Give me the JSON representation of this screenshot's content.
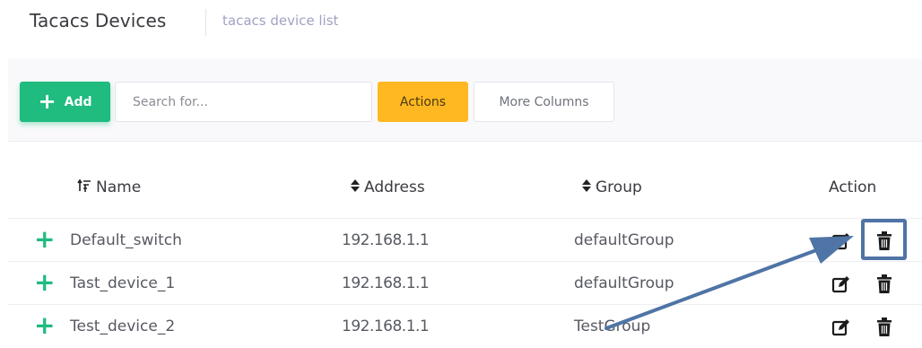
{
  "header": {
    "title": "Tacacs Devices",
    "subtitle": "tacacs device list"
  },
  "toolbar": {
    "add_label": "Add",
    "add_icon": "plus-icon",
    "search_placeholder": "Search for...",
    "actions_label": "Actions",
    "more_columns_label": "More Columns"
  },
  "table": {
    "columns": {
      "name": "Name",
      "address": "Address",
      "group": "Group",
      "action": "Action"
    },
    "rows": [
      {
        "name": "Default_switch",
        "address": "192.168.1.1",
        "group": "defaultGroup"
      },
      {
        "name": "Tast_device_1",
        "address": "192.168.1.1",
        "group": "defaultGroup"
      },
      {
        "name": "Test_device_2",
        "address": "192.168.1.1",
        "group": "TestGroup"
      }
    ]
  },
  "colors": {
    "add_button": "#1fbb7f",
    "actions_button": "#ffb822",
    "subtitle": "#9fa3c2",
    "highlight": "#4f74a6"
  },
  "icons": {
    "sort_active": "sort-amount-up-icon",
    "sort": "sort-icon",
    "edit": "edit-icon",
    "delete": "trash-icon",
    "expand": "plus-icon"
  }
}
